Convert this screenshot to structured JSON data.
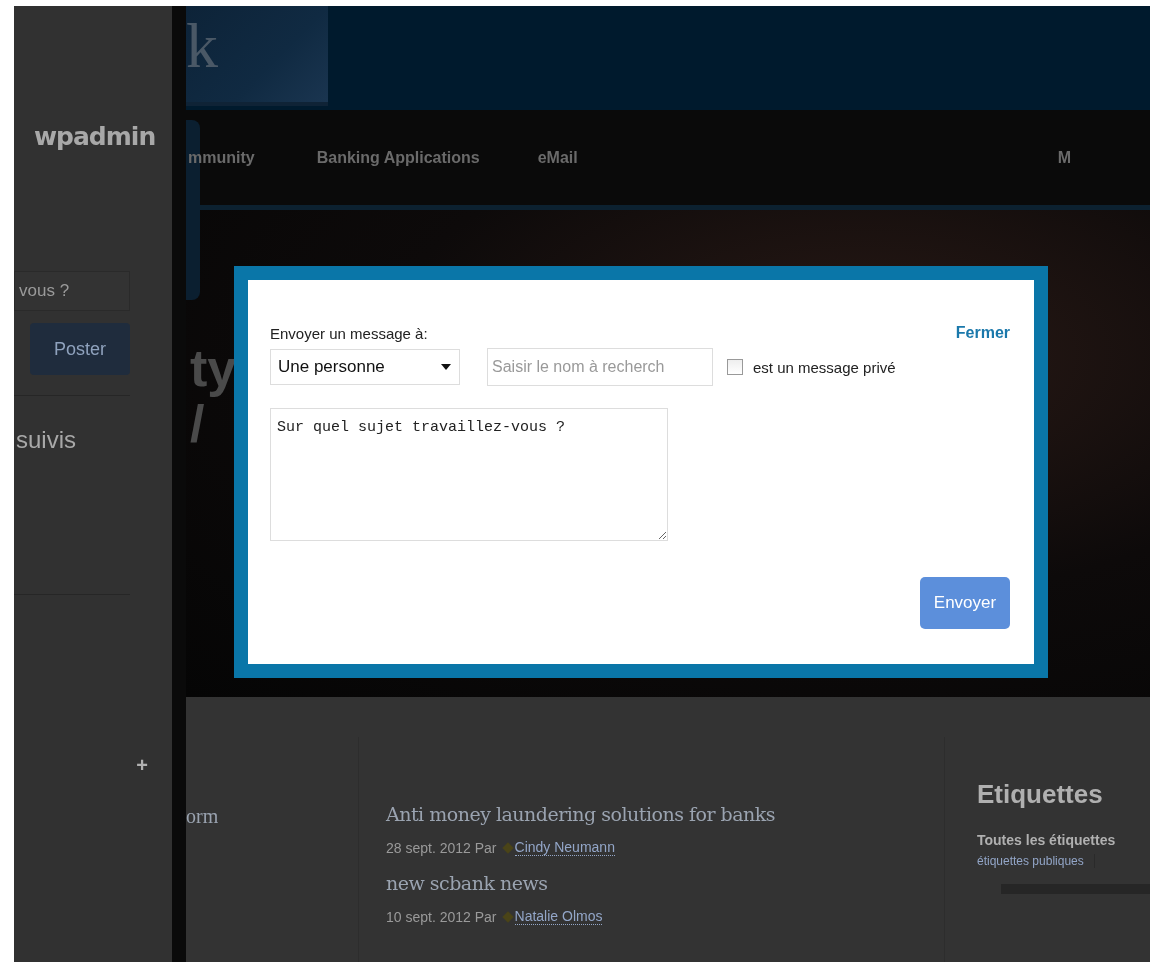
{
  "sidebar": {
    "user": "wpadmin",
    "status_field": {
      "placeholder": "vous ?"
    },
    "post_button": "Poster",
    "following_heading": "suivis",
    "add_button": "+"
  },
  "header": {
    "logo_text": "k"
  },
  "nav": {
    "items": [
      {
        "label": "mmunity"
      },
      {
        "label": "Banking Applications"
      },
      {
        "label": "eMail"
      },
      {
        "label": "M"
      }
    ]
  },
  "hero": {
    "text_lines": [
      "ty",
      "/"
    ]
  },
  "modal": {
    "title": "Envoyer un message à:",
    "close_link": "Fermer",
    "recipient_select": {
      "value": "Une personne"
    },
    "name_field": {
      "placeholder": "Saisir le nom à recherch"
    },
    "private_checkbox": {
      "label": "est un message privé",
      "checked": false
    },
    "message_field": {
      "value": "Sur quel sujet travaillez-vous ?"
    },
    "send_button": "Envoyer"
  },
  "content": {
    "left_fragment": "orm",
    "posts": [
      {
        "title": "Anti money laundering solutions for banks",
        "meta": "28 sept. 2012 Par",
        "author": "Cindy Neumann"
      },
      {
        "title": "new scbank news",
        "meta": "10 sept. 2012 Par",
        "author": "Natalie Olmos"
      }
    ],
    "tags": {
      "title": "Etiquettes",
      "subtitle": "Toutes les étiquettes",
      "link": "étiquettes publiques"
    }
  }
}
